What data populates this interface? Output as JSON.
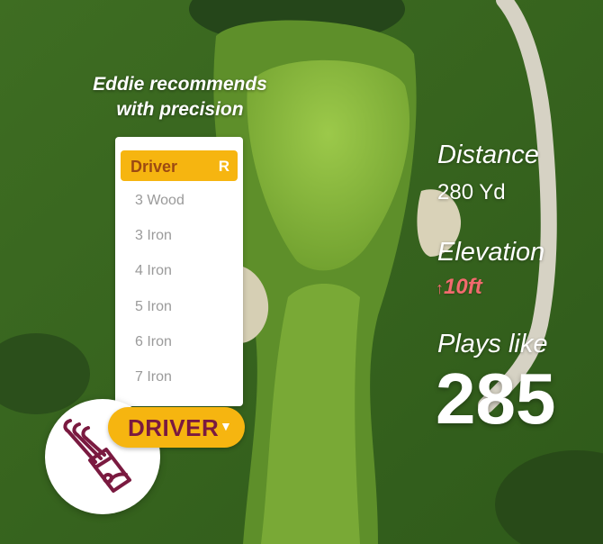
{
  "headline": {
    "line1": "Eddie recommends",
    "line2": "with precision"
  },
  "club_list": {
    "selected": {
      "name": "Driver",
      "tag": "R"
    },
    "items": [
      "3 Wood",
      "3 Iron",
      "4 Iron",
      "5 Iron",
      "6 Iron",
      "7 Iron"
    ]
  },
  "driver_button": {
    "label": "DRIVER",
    "caret_icon": "caret-down-icon"
  },
  "avatar": {
    "icon": "golf-bag-icon"
  },
  "stats": {
    "distance_label": "Distance",
    "distance_value": "280 Yd",
    "elevation_label": "Elevation",
    "elevation_value": "10ft",
    "elevation_icon": "arrow-up-icon",
    "plays_like_label": "Plays like",
    "plays_like_value": "285"
  },
  "colors": {
    "accent": "#f6b510",
    "brand": "#7a1a40",
    "elevation": "#f26a6e"
  }
}
